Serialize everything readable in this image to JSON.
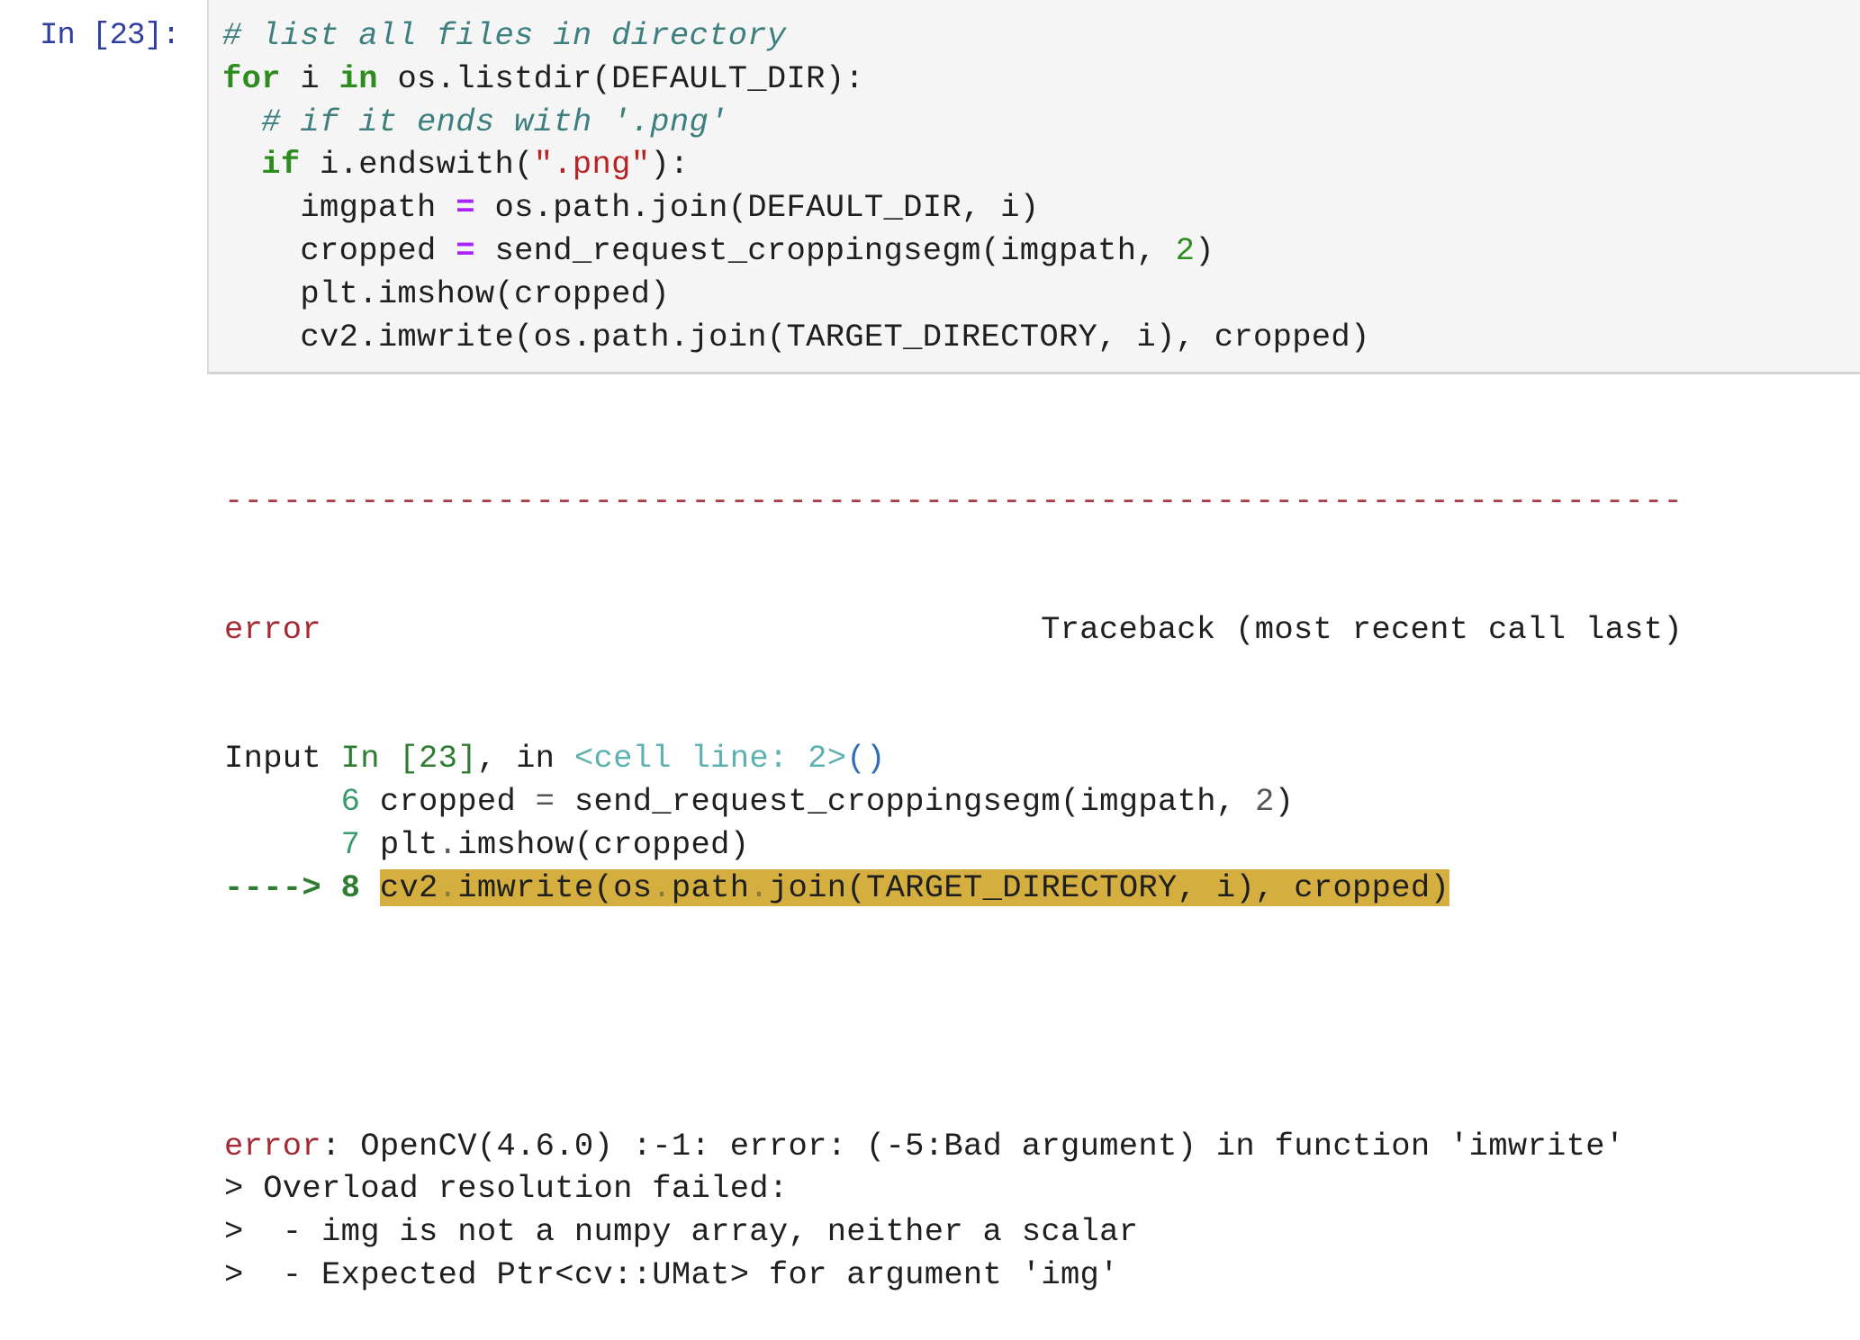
{
  "cell": {
    "prompt": "In [23]:",
    "code_lines": [
      [
        {
          "t": "# list all files in directory",
          "c": "comment"
        }
      ],
      [
        {
          "t": "for",
          "c": "keyword"
        },
        {
          "t": " i ",
          "c": "plain"
        },
        {
          "t": "in",
          "c": "keyword"
        },
        {
          "t": " os.listdir(DEFAULT_DIR):",
          "c": "plain"
        }
      ],
      [
        {
          "t": "  ",
          "c": "plain"
        },
        {
          "t": "# if it ends with '.png'",
          "c": "comment"
        }
      ],
      [
        {
          "t": "  ",
          "c": "plain"
        },
        {
          "t": "if",
          "c": "keyword"
        },
        {
          "t": " i.endswith(",
          "c": "plain"
        },
        {
          "t": "\".png\"",
          "c": "string"
        },
        {
          "t": "):",
          "c": "plain"
        }
      ],
      [
        {
          "t": "    imgpath ",
          "c": "plain"
        },
        {
          "t": "=",
          "c": "op"
        },
        {
          "t": " os.path.join(DEFAULT_DIR, i)",
          "c": "plain"
        }
      ],
      [
        {
          "t": "    cropped ",
          "c": "plain"
        },
        {
          "t": "=",
          "c": "op"
        },
        {
          "t": " send_request_croppingsegm(imgpath, ",
          "c": "plain"
        },
        {
          "t": "2",
          "c": "number"
        },
        {
          "t": ")",
          "c": "plain"
        }
      ],
      [
        {
          "t": "    plt.imshow(cropped)",
          "c": "plain"
        }
      ],
      [
        {
          "t": "    cv2.imwrite(os.path.join(TARGET_DIRECTORY, i), cropped)",
          "c": "plain"
        }
      ]
    ]
  },
  "output": {
    "separator": "---------------------------------------------------------------------------",
    "error_name": "error",
    "traceback_label": "Traceback (most recent call last)",
    "trace_lines": [
      [
        {
          "t": "Input ",
          "c": "plain"
        },
        {
          "t": "In [23]",
          "c": "green"
        },
        {
          "t": ", in ",
          "c": "plain"
        },
        {
          "t": "<cell line: 2>",
          "c": "teal"
        },
        {
          "t": "()",
          "c": "blue"
        }
      ],
      [
        {
          "t": "      ",
          "c": "plain"
        },
        {
          "t": "6",
          "c": "lineno"
        },
        {
          "t": " cropped ",
          "c": "plain"
        },
        {
          "t": "=",
          "c": "grey"
        },
        {
          "t": " send_request_croppingsegm(imgpath, ",
          "c": "plain"
        },
        {
          "t": "2",
          "c": "grey"
        },
        {
          "t": ")",
          "c": "plain"
        }
      ],
      [
        {
          "t": "      ",
          "c": "plain"
        },
        {
          "t": "7",
          "c": "lineno"
        },
        {
          "t": " plt",
          "c": "plain"
        },
        {
          "t": ".",
          "c": "grey"
        },
        {
          "t": "imshow(cropped)",
          "c": "plain"
        }
      ],
      [
        {
          "t": "----> 8",
          "c": "arrow"
        },
        {
          "t": " ",
          "c": "plain"
        },
        {
          "t": "cv2",
          "c": "plain",
          "hl": true
        },
        {
          "t": ".",
          "c": "dot",
          "hl": true
        },
        {
          "t": "imwrite(os",
          "c": "plain",
          "hl": true
        },
        {
          "t": ".",
          "c": "dot",
          "hl": true
        },
        {
          "t": "path",
          "c": "plain",
          "hl": true
        },
        {
          "t": ".",
          "c": "dot",
          "hl": true
        },
        {
          "t": "join(TARGET_DIRECTORY, i), cropped)",
          "c": "plain",
          "hl": true
        }
      ]
    ],
    "message_lines": [
      [
        {
          "t": "error",
          "c": "errname"
        },
        {
          "t": ": OpenCV(4.6.0) :-1: error: (-5:Bad argument) in function 'imwrite'",
          "c": "plain"
        }
      ],
      [
        {
          "t": "> Overload resolution failed:",
          "c": "plain"
        }
      ],
      [
        {
          "t": ">  - img is not a numpy array, neither a scalar",
          "c": "plain"
        }
      ],
      [
        {
          "t": ">  - Expected Ptr<cv::UMat> for argument 'img'",
          "c": "plain"
        }
      ]
    ]
  },
  "colors": {
    "prompt": "#303f9f",
    "cell_background": "#f5f5f5",
    "highlight": "#d4ae3f",
    "keyword": "#2e8b1e",
    "comment": "#3d7f7f",
    "string": "#ba2121",
    "operator": "#aa22ff",
    "error": "#a52a35"
  }
}
